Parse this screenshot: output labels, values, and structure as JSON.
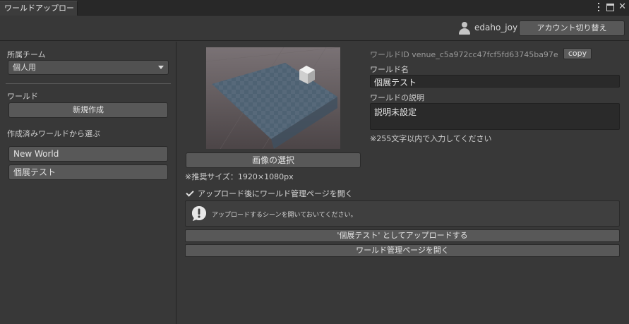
{
  "window": {
    "tab_title": "ワールドアップロード"
  },
  "account": {
    "username": "edaho_joy",
    "switch_label": "アカウント切り替え"
  },
  "left": {
    "team_label": "所属チーム",
    "team_selected": "個人用",
    "world_section_label": "ワールド",
    "new_button_label": "新規作成",
    "select_existing_label": "作成済みワールドから選ぶ",
    "worlds": [
      "New World",
      "個展テスト"
    ]
  },
  "right": {
    "select_image_label": "画像の選択",
    "recommended_size": "※推奨サイズ：1920×1080px",
    "world_id_text": "ワールドID venue_c5a972cc47fcf5fd63745ba97e",
    "copy_label": "copy",
    "name_label": "ワールド名",
    "name_value": "個展テスト",
    "desc_label": "ワールドの説明",
    "desc_value": "説明未設定",
    "char_limit_note": "※255文字以内で入力してください",
    "open_after_upload_label": "アップロード後にワールド管理ページを開く",
    "open_after_upload_checked": true,
    "help_message": "アップロードするシーンを開いておいてください。",
    "upload_button_label": "'個展テスト' としてアップロードする",
    "open_manage_button_label": "ワールド管理ページを開く"
  },
  "icons": {
    "user": "user-icon",
    "warning": "warning-icon",
    "menu": "kebab-menu-icon",
    "maximize": "maximize-icon",
    "close": "close-icon",
    "dropdown": "chevron-down-icon"
  },
  "colors": {
    "background": "#383838",
    "tabbar": "#282828",
    "button": "#585858",
    "field": "#2a2a2a"
  }
}
